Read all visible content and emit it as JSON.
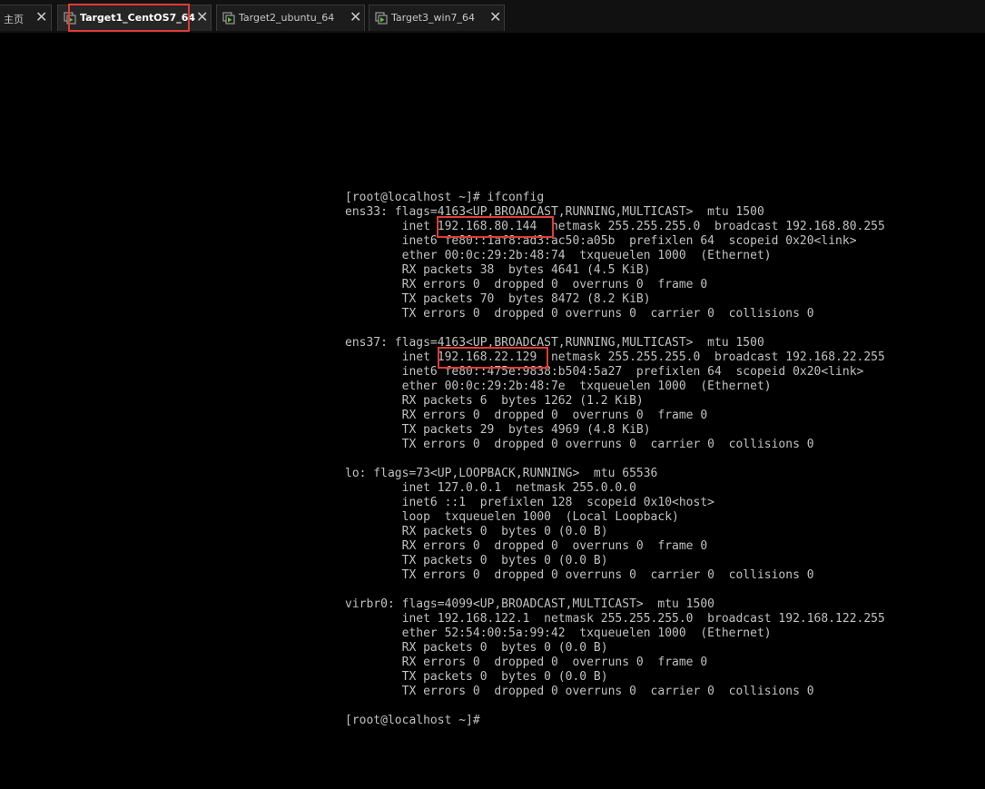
{
  "tabs": [
    {
      "label": "主页",
      "icon": "home-tab",
      "active": false
    },
    {
      "label": "Target1_CentOS7_64",
      "icon": "vm-icon",
      "active": true
    },
    {
      "label": "Target2_ubuntu_64",
      "icon": "vm-icon",
      "active": false
    },
    {
      "label": "Target3_win7_64",
      "icon": "vm-icon",
      "active": false
    }
  ],
  "close_glyph": "✕",
  "colors": {
    "background": "#000000",
    "terminal_text": "#c0c0c0",
    "highlight": "#e03b35",
    "vm_icon_play": "#56c43a"
  },
  "terminal_lines": [
    "[root@localhost ~]# ifconfig",
    "ens33: flags=4163<UP,BROADCAST,RUNNING,MULTICAST>  mtu 1500",
    "        inet 192.168.80.144  netmask 255.255.255.0  broadcast 192.168.80.255",
    "        inet6 fe80::1af8:ad3:ac50:a05b  prefixlen 64  scopeid 0x20<link>",
    "        ether 00:0c:29:2b:48:74  txqueuelen 1000  (Ethernet)",
    "        RX packets 38  bytes 4641 (4.5 KiB)",
    "        RX errors 0  dropped 0  overruns 0  frame 0",
    "        TX packets 70  bytes 8472 (8.2 KiB)",
    "        TX errors 0  dropped 0 overruns 0  carrier 0  collisions 0",
    "",
    "ens37: flags=4163<UP,BROADCAST,RUNNING,MULTICAST>  mtu 1500",
    "        inet 192.168.22.129  netmask 255.255.255.0  broadcast 192.168.22.255",
    "        inet6 fe80::475e:9838:b504:5a27  prefixlen 64  scopeid 0x20<link>",
    "        ether 00:0c:29:2b:48:7e  txqueuelen 1000  (Ethernet)",
    "        RX packets 6  bytes 1262 (1.2 KiB)",
    "        RX errors 0  dropped 0  overruns 0  frame 0",
    "        TX packets 29  bytes 4969 (4.8 KiB)",
    "        TX errors 0  dropped 0 overruns 0  carrier 0  collisions 0",
    "",
    "lo: flags=73<UP,LOOPBACK,RUNNING>  mtu 65536",
    "        inet 127.0.0.1  netmask 255.0.0.0",
    "        inet6 ::1  prefixlen 128  scopeid 0x10<host>",
    "        loop  txqueuelen 1000  (Local Loopback)",
    "        RX packets 0  bytes 0 (0.0 B)",
    "        RX errors 0  dropped 0  overruns 0  frame 0",
    "        TX packets 0  bytes 0 (0.0 B)",
    "        TX errors 0  dropped 0 overruns 0  carrier 0  collisions 0",
    "",
    "virbr0: flags=4099<UP,BROADCAST,MULTICAST>  mtu 1500",
    "        inet 192.168.122.1  netmask 255.255.255.0  broadcast 192.168.122.255",
    "        ether 52:54:00:5a:99:42  txqueuelen 1000  (Ethernet)",
    "        RX packets 0  bytes 0 (0.0 B)",
    "        RX errors 0  dropped 0  overruns 0  frame 0",
    "        TX packets 0  bytes 0 (0.0 B)",
    "        TX errors 0  dropped 0 overruns 0  carrier 0  collisions 0",
    "",
    "[root@localhost ~]#"
  ]
}
